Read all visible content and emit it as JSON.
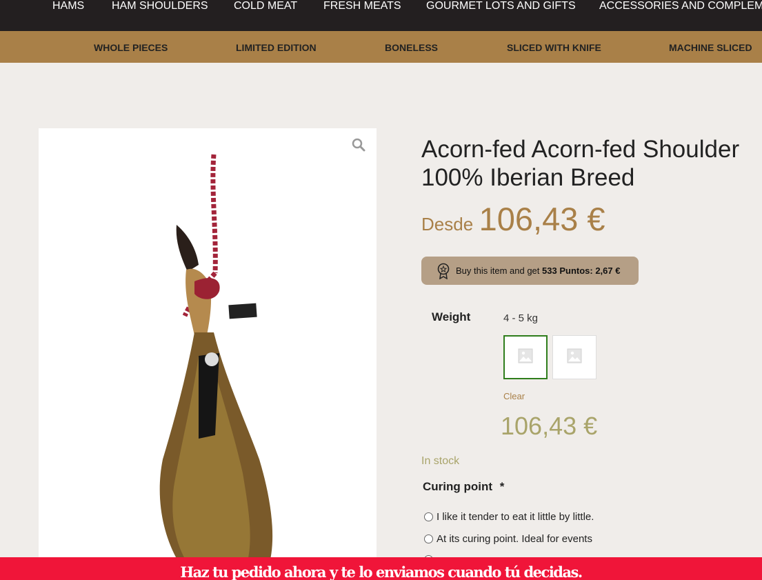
{
  "top_nav": {
    "items": [
      "HAMS",
      "HAM SHOULDERS",
      "COLD MEAT",
      "FRESH MEATS",
      "GOURMET LOTS AND GIFTS",
      "ACCESSORIES AND COMPLEM"
    ]
  },
  "sub_nav": {
    "items": [
      "WHOLE PIECES",
      "LIMITED EDITION",
      "BONELESS",
      "SLICED WITH KNIFE",
      "MACHINE SLICED"
    ]
  },
  "product": {
    "title_line1": "Acorn-fed Acorn-fed Shoulder",
    "title_line2": "100% Iberian Breed",
    "price_prefix": "Desde",
    "price": "106,43 €",
    "points": {
      "text": "Buy this item and get",
      "bold": "533 Puntos: 2,67 €"
    },
    "weight": {
      "label": "Weight",
      "selected": "4 - 5 kg",
      "clear": "Clear"
    },
    "variation_price": "106,43 €",
    "stock": "In stock",
    "curing": {
      "label": "Curing point",
      "required": "*",
      "options": [
        "I like it tender to eat it little by little.",
        "At its curing point. Ideal for events"
      ]
    }
  },
  "banner": {
    "text": "Haz tu pedido ahora y te lo enviamos cuando tú decidas."
  },
  "colors": {
    "top_nav_bg": "#231f20",
    "sub_nav_bg": "#a98048",
    "accent": "#a98048",
    "stock_green": "#a9a46a",
    "banner_red": "#f01539"
  }
}
